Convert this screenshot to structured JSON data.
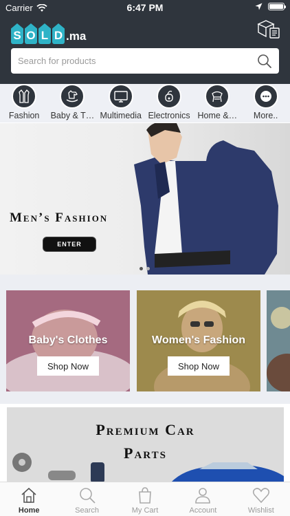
{
  "status_bar": {
    "carrier": "Carrier",
    "time": "6:47 PM"
  },
  "header": {
    "logo_letters": [
      "S",
      "O",
      "L",
      "D"
    ],
    "logo_suffix": ".ma",
    "search_placeholder": "Search for products"
  },
  "categories": [
    {
      "label": "Fashion",
      "icon": "fashion-icon"
    },
    {
      "label": "Baby & T…",
      "icon": "rocking-horse-icon"
    },
    {
      "label": "Multimedia",
      "icon": "monitor-icon"
    },
    {
      "label": "Electronics",
      "icon": "vacuum-icon"
    },
    {
      "label": "Home &…",
      "icon": "chair-icon"
    },
    {
      "label": "More..",
      "icon": "more-icon"
    }
  ],
  "hero": {
    "title": "Men’s Fashion",
    "button": "ENTER",
    "active_slide": 1,
    "slides": 2
  },
  "promos": [
    {
      "title": "Baby's Clothes",
      "button": "Shop Now"
    },
    {
      "title": "Women's Fashion",
      "button": "Shop Now"
    }
  ],
  "car_banner": {
    "line1": "Premium Car",
    "line2": "Parts"
  },
  "tabs": [
    {
      "label": "Home",
      "icon": "home-icon",
      "active": true
    },
    {
      "label": "Search",
      "icon": "search-icon",
      "active": false
    },
    {
      "label": "My Cart",
      "icon": "bag-icon",
      "active": false
    },
    {
      "label": "Account",
      "icon": "person-icon",
      "active": false
    },
    {
      "label": "Wishlist",
      "icon": "heart-icon",
      "active": false
    }
  ],
  "colors": {
    "header": "#2f353d",
    "logo_tag": "#2fb3c7",
    "category_bg": "#eef0f5"
  }
}
